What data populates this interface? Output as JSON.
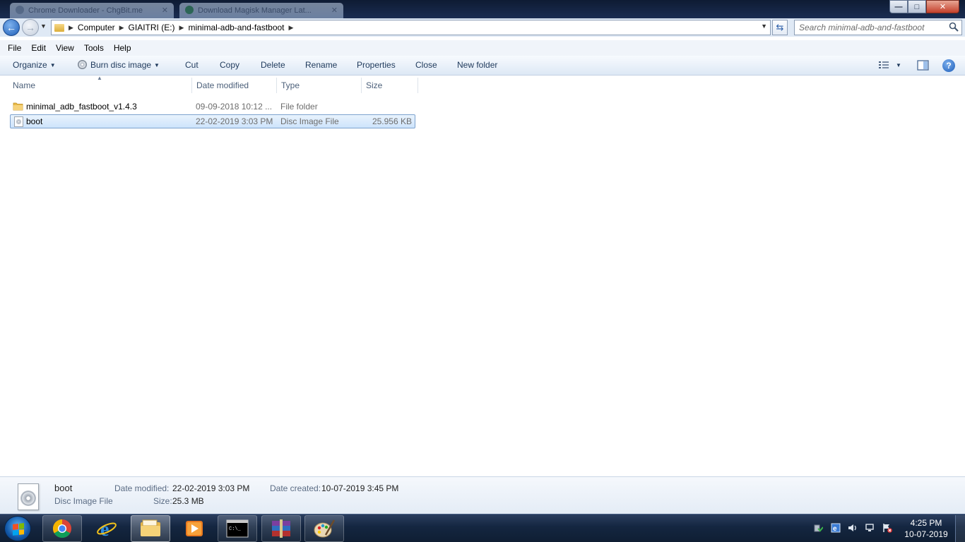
{
  "window": {
    "background_tabs": [
      "Chrome Downloader - ChgBit.me",
      "Download Magisk Manager Lat..."
    ],
    "controls": {
      "minimize": "—",
      "maximize": "□",
      "close": "✕"
    }
  },
  "address": {
    "breadcrumbs": [
      "Computer",
      "GIAITRI (E:)",
      "minimal-adb-and-fastboot"
    ],
    "search_placeholder": "Search minimal-adb-and-fastboot"
  },
  "menu": [
    "File",
    "Edit",
    "View",
    "Tools",
    "Help"
  ],
  "commands": {
    "organize": "Organize",
    "burn": "Burn disc image",
    "cut": "Cut",
    "copy": "Copy",
    "delete": "Delete",
    "rename": "Rename",
    "properties": "Properties",
    "close": "Close",
    "new_folder": "New folder"
  },
  "columns": {
    "name": "Name",
    "date": "Date modified",
    "type": "Type",
    "size": "Size"
  },
  "files": [
    {
      "name": "minimal_adb_fastboot_v1.4.3",
      "date": "09-09-2018 10:12 ...",
      "type": "File folder",
      "size": "",
      "icon": "folder-icon",
      "selected": false
    },
    {
      "name": "boot",
      "date": "22-02-2019 3:03 PM",
      "type": "Disc Image File",
      "size": "25.956 KB",
      "icon": "disc-image-icon",
      "selected": true
    }
  ],
  "details": {
    "name": "boot",
    "type": "Disc Image File",
    "date_modified_label": "Date modified:",
    "date_modified": "22-02-2019 3:03 PM",
    "size_label": "Size:",
    "size": "25.3 MB",
    "date_created_label": "Date created:",
    "date_created": "10-07-2019 3:45 PM"
  },
  "taskbar": {
    "apps": [
      "chrome-icon",
      "internet-explorer-icon",
      "windows-explorer-icon",
      "media-player-icon",
      "command-prompt-icon",
      "winrar-icon",
      "paint-icon"
    ],
    "clock": {
      "time": "4:25 PM",
      "date": "10-07-2019"
    }
  },
  "colors": {
    "selection": "#cde3fb",
    "command_text": "#1e395b",
    "taskbar": "#142640"
  }
}
